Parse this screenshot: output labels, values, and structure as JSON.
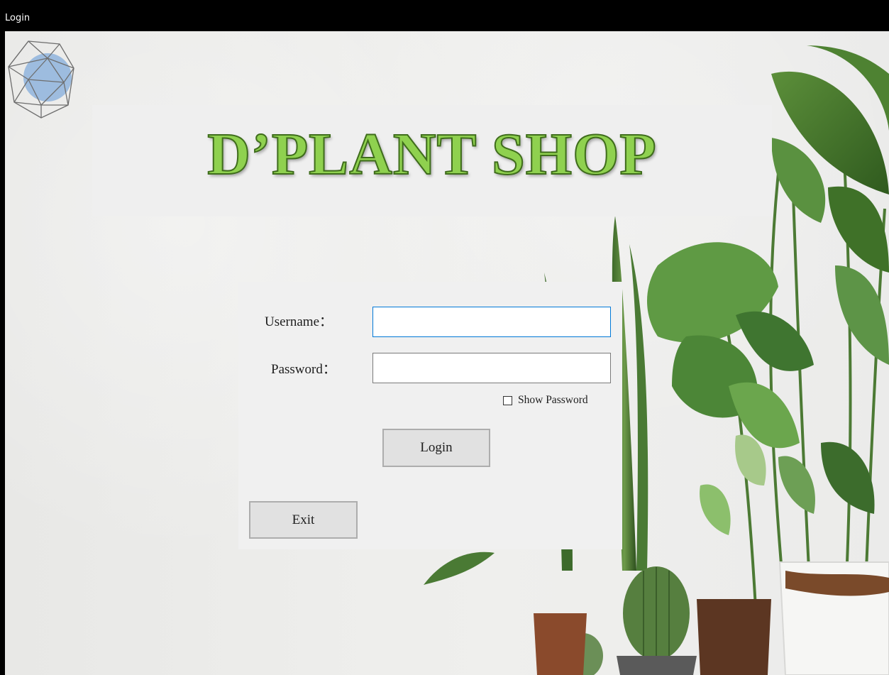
{
  "window": {
    "title": "Login"
  },
  "banner": {
    "title": "D’PLANT SHOP"
  },
  "login_form": {
    "username_label": "Username：",
    "username_value": "",
    "password_label": "Password：",
    "password_value": "",
    "show_password_label": "Show Password",
    "show_password_checked": false,
    "login_button": "Login",
    "exit_button": "Exit"
  },
  "icons": [
    "geodesic-logo-icon",
    "checkbox-icon"
  ],
  "colors": {
    "title_green": "#8fd14f",
    "title_outline": "#3f6d1c",
    "focus_blue": "#0078d7"
  }
}
